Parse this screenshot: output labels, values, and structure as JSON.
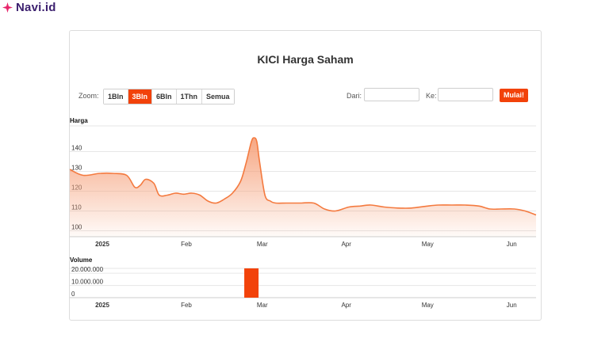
{
  "brand": {
    "name": "Navi.id",
    "accent": "#e8256b"
  },
  "chart": {
    "title": "KICI Harga Saham",
    "zoom_label": "Zoom:",
    "zoom_buttons": [
      "1Bln",
      "3Bln",
      "6Bln",
      "1Thn",
      "Semua"
    ],
    "zoom_active": "3Bln",
    "from_label": "Dari:",
    "to_label": "Ke:",
    "from_value": "",
    "to_value": "",
    "go_label": "Mulai!"
  },
  "colors": {
    "accent": "#f2420a",
    "line": "#f47a3f",
    "area": "#f6a27c"
  },
  "chart_data": [
    {
      "type": "area",
      "title": "Harga",
      "ylim": [
        97,
        153
      ],
      "yticks": [
        100,
        110,
        120,
        130,
        140
      ],
      "xlim": [
        "2024-12-20",
        "2025-06-10"
      ],
      "xticks": [
        {
          "date": "2025-01-01",
          "label": "2025",
          "bold": true
        },
        {
          "date": "2025-02-01",
          "label": "Feb",
          "bold": false
        },
        {
          "date": "2025-03-01",
          "label": "Mar",
          "bold": false
        },
        {
          "date": "2025-04-01",
          "label": "Apr",
          "bold": false
        },
        {
          "date": "2025-05-01",
          "label": "May",
          "bold": false
        },
        {
          "date": "2025-06-01",
          "label": "Jun",
          "bold": false
        }
      ],
      "x": [
        "2024-12-20",
        "2024-12-25",
        "2024-12-31",
        "2025-01-05",
        "2025-01-10",
        "2025-01-13",
        "2025-01-15",
        "2025-01-17",
        "2025-01-20",
        "2025-01-22",
        "2025-01-25",
        "2025-01-28",
        "2025-01-31",
        "2025-02-03",
        "2025-02-06",
        "2025-02-09",
        "2025-02-12",
        "2025-02-15",
        "2025-02-18",
        "2025-02-21",
        "2025-02-23",
        "2025-02-25",
        "2025-02-26",
        "2025-02-27",
        "2025-02-28",
        "2025-03-02",
        "2025-03-04",
        "2025-03-06",
        "2025-03-10",
        "2025-03-15",
        "2025-03-20",
        "2025-03-24",
        "2025-03-28",
        "2025-04-02",
        "2025-04-06",
        "2025-04-10",
        "2025-04-15",
        "2025-04-20",
        "2025-04-25",
        "2025-05-01",
        "2025-05-05",
        "2025-05-10",
        "2025-05-15",
        "2025-05-20",
        "2025-05-24",
        "2025-05-28",
        "2025-06-02",
        "2025-06-06",
        "2025-06-10"
      ],
      "values": [
        131,
        128,
        129,
        129,
        128,
        122,
        123,
        126,
        124,
        118,
        118,
        119,
        118.5,
        119,
        118,
        115,
        114,
        116,
        119,
        125,
        134,
        145,
        147,
        145,
        135,
        118,
        115,
        114,
        114,
        114,
        114,
        111,
        110,
        112,
        112.5,
        113,
        112,
        111.5,
        111.5,
        112.5,
        113,
        113,
        113,
        112.5,
        111,
        111,
        111,
        110,
        108
      ]
    },
    {
      "type": "bar",
      "title": "Volume",
      "ylim": [
        0,
        24000000
      ],
      "yticks": [
        {
          "value": 0,
          "label": "0"
        },
        {
          "value": 10000000,
          "label": "10.000.000"
        },
        {
          "value": 20000000,
          "label": "20.000.000"
        }
      ],
      "x": [
        "2025-02-25"
      ],
      "values": [
        24000000
      ]
    }
  ]
}
